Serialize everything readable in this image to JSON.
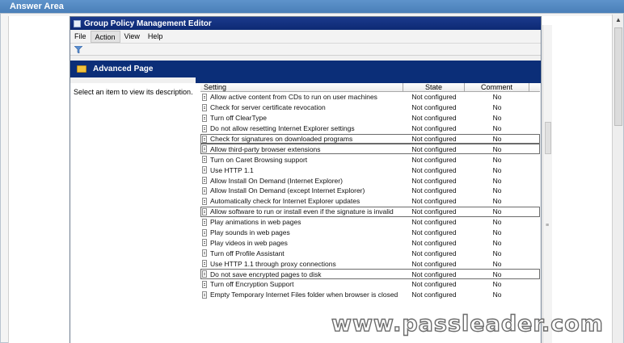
{
  "answer_area": {
    "title": "Answer Area"
  },
  "window": {
    "title": "Group Policy Management Editor",
    "menu": [
      "File",
      "Action",
      "View",
      "Help"
    ],
    "banner_title": "Advanced Page",
    "description": "Select an item to view its description."
  },
  "table": {
    "headers": {
      "setting": "Setting",
      "state": "State",
      "comment": "Comment"
    },
    "rows": [
      {
        "setting": "Allow active content from CDs to run on user machines",
        "state": "Not configured",
        "comment": "No",
        "boxed": false
      },
      {
        "setting": "Check for server certificate revocation",
        "state": "Not configured",
        "comment": "No",
        "boxed": false
      },
      {
        "setting": "Turn off ClearType",
        "state": "Not configured",
        "comment": "No",
        "boxed": false
      },
      {
        "setting": "Do not allow resetting Internet Explorer settings",
        "state": "Not configured",
        "comment": "No",
        "boxed": false
      },
      {
        "setting": "Check for signatures on downloaded programs",
        "state": "Not configured",
        "comment": "No",
        "boxed": true
      },
      {
        "setting": "Allow third-party browser extensions",
        "state": "Not configured",
        "comment": "No",
        "boxed": true
      },
      {
        "setting": "Turn on Caret Browsing support",
        "state": "Not configured",
        "comment": "No",
        "boxed": false
      },
      {
        "setting": "Use HTTP 1.1",
        "state": "Not configured",
        "comment": "No",
        "boxed": false
      },
      {
        "setting": "Allow Install On Demand (Internet Explorer)",
        "state": "Not configured",
        "comment": "No",
        "boxed": false
      },
      {
        "setting": "Allow Install On Demand (except Internet Explorer)",
        "state": "Not configured",
        "comment": "No",
        "boxed": false
      },
      {
        "setting": "Automatically check for Internet Explorer updates",
        "state": "Not configured",
        "comment": "No",
        "boxed": false
      },
      {
        "setting": "Allow software to run or install even if the signature is invalid",
        "state": "Not configured",
        "comment": "No",
        "boxed": true
      },
      {
        "setting": "Play animations in web pages",
        "state": "Not configured",
        "comment": "No",
        "boxed": false
      },
      {
        "setting": "Play sounds in web pages",
        "state": "Not configured",
        "comment": "No",
        "boxed": false
      },
      {
        "setting": "Play videos in web pages",
        "state": "Not configured",
        "comment": "No",
        "boxed": false
      },
      {
        "setting": "Turn off Profile Assistant",
        "state": "Not configured",
        "comment": "No",
        "boxed": false
      },
      {
        "setting": "Use HTTP 1.1 through proxy connections",
        "state": "Not configured",
        "comment": "No",
        "boxed": false
      },
      {
        "setting": "Do not save encrypted pages to disk",
        "state": "Not configured",
        "comment": "No",
        "boxed": true
      },
      {
        "setting": "Turn off Encryption Support",
        "state": "Not configured",
        "comment": "No",
        "boxed": false
      },
      {
        "setting": "Empty Temporary Internet Files folder when browser is closed",
        "state": "Not configured",
        "comment": "No",
        "boxed": false
      }
    ]
  },
  "watermark": "www.passleader.com",
  "colors": {
    "titlebar": "#0d2a74",
    "banner": "#0b2e78",
    "page": "#5b8fc5"
  }
}
